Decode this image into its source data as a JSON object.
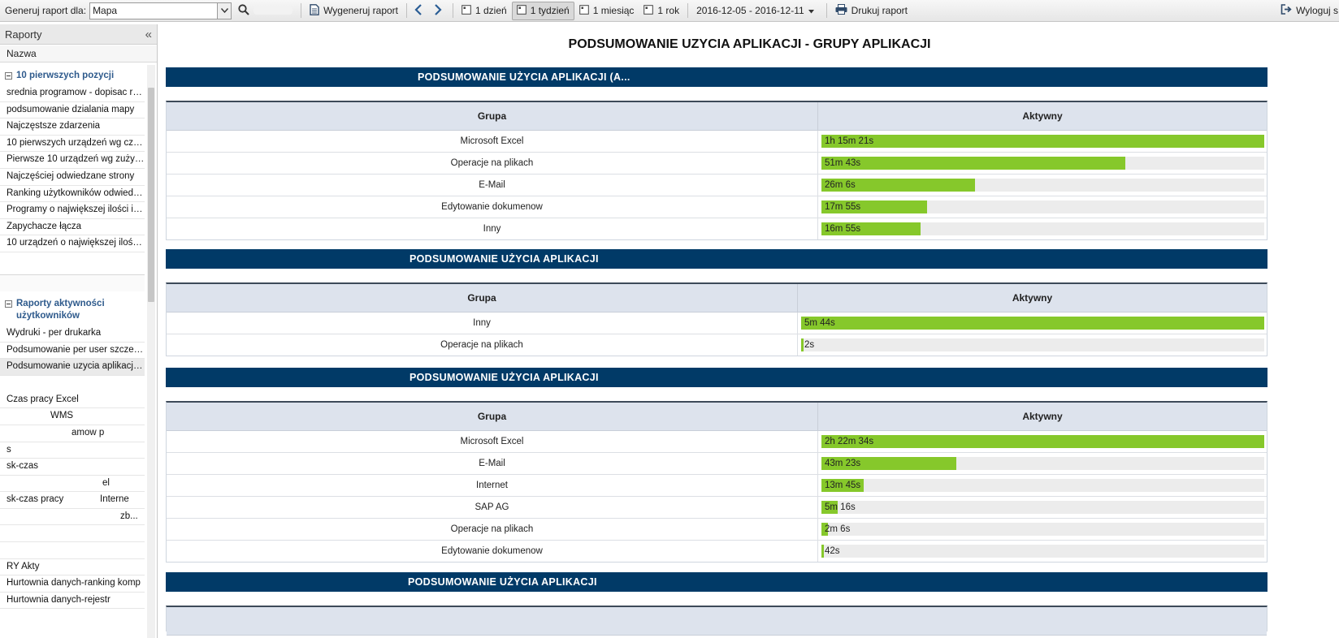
{
  "toolbar": {
    "generate_for_label": "Generuj raport dla:",
    "generate_for_value": "Mapa",
    "generate_button": "Wygeneruj raport",
    "ranges": [
      "1 dzień",
      "1 tydzień",
      "1 miesiąc",
      "1 rok"
    ],
    "active_range": "1 tydzień",
    "date_range": "2016-12-05 - 2016-12-11",
    "print_button": "Drukuj raport",
    "logout_button": "Wyloguj s"
  },
  "sidebar": {
    "title": "Raporty",
    "collapse_glyph": "«",
    "column_header": "Nazwa",
    "groups": [
      {
        "label": "10 pierwszych pozycji",
        "items": [
          "srednia programow - dopisac res...",
          "podsumowanie dzialania mapy",
          "Najczęstsze zdarzenia",
          "10 pierwszych urządzeń wg czas...",
          "Pierwsze 10 urządzeń wg zużycia...",
          "Najczęściej odwiedzane strony",
          "Ranking użytkowników odwiedzaj...",
          "Programy o największej ilości ins...",
          "Zapychacze łącza",
          "10 urządzeń o największej ilości ..."
        ]
      },
      {
        "label": "Raporty aktywności użytkowników",
        "items": [
          "Wydruki - per drukarka",
          "Podsumowanie per user szczegol...",
          "Podsumowanie uzycia aplikacji - ..."
        ]
      }
    ],
    "lower_items": [
      "Czas pracy Excel",
      "WMS",
      "amow p",
      "s",
      "sk-czas",
      "el",
      "sk-czas pracy              Interne",
      "zb...",
      "",
      "",
      "RY Akty",
      "Hurtownia danych-ranking komp",
      "Hurtownia danych-rejestr"
    ]
  },
  "report": {
    "title": "PODSUMOWANIE UZYCIA APLIKACJI - GRUPY APLIKACJI",
    "col_group": "Grupa",
    "col_active": "Aktywny",
    "sections": [
      {
        "heading": "PODSUMOWANIE UŻYCIA APLIKACJI (A...",
        "rows": [
          {
            "group": "Microsoft Excel",
            "value": "1h 15m 21s",
            "fraction": 1.0
          },
          {
            "group": "Operacje na plikach",
            "value": "51m 43s",
            "fraction": 0.686
          },
          {
            "group": "E-Mail",
            "value": "26m 6s",
            "fraction": 0.346
          },
          {
            "group": "Edytowanie dokumenow",
            "value": "17m 55s",
            "fraction": 0.238
          },
          {
            "group": "Inny",
            "value": "16m 55s",
            "fraction": 0.224
          }
        ]
      },
      {
        "heading": "PODSUMOWANIE UŻYCIA APLIKACJI",
        "rows": [
          {
            "group": "Inny",
            "value": "5m 44s",
            "fraction": 1.0
          },
          {
            "group": "Operacje na plikach",
            "value": "2s",
            "fraction": 0.006
          }
        ]
      },
      {
        "heading": "PODSUMOWANIE UŻYCIA APLIKACJI",
        "rows": [
          {
            "group": "Microsoft Excel",
            "value": "2h 22m 34s",
            "fraction": 1.0
          },
          {
            "group": "E-Mail",
            "value": "43m 23s",
            "fraction": 0.304
          },
          {
            "group": "Internet",
            "value": "13m 45s",
            "fraction": 0.096
          },
          {
            "group": "SAP AG",
            "value": "5m 16s",
            "fraction": 0.037
          },
          {
            "group": "Operacje na plikach",
            "value": "2m 6s",
            "fraction": 0.015
          },
          {
            "group": "Edytowanie dokumenow",
            "value": "42s",
            "fraction": 0.005
          }
        ]
      },
      {
        "heading": "PODSUMOWANIE UŻYCIA APLIKACJI",
        "rows": []
      }
    ]
  },
  "colors": {
    "banner": "#013a67",
    "bar_fill": "#86c82b",
    "bar_track": "#ececec",
    "header_row": "#dde3ed",
    "sidebar_group": "#2e5a8c"
  }
}
